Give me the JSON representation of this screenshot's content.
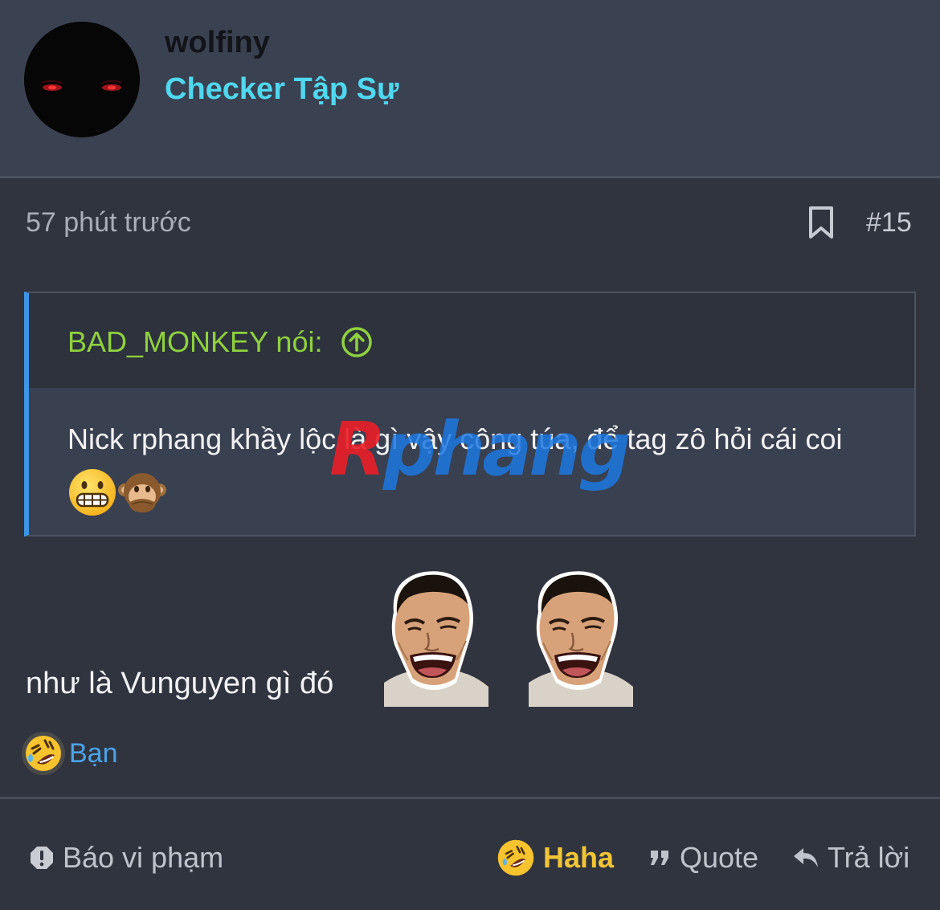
{
  "post": {
    "author": {
      "name": "wolfiny",
      "title": "Checker Tập Sự",
      "avatar_icon": "dark-avatar-red-eyes"
    },
    "timestamp": "57 phút trước",
    "post_number": "#15",
    "quote": {
      "author_label": "BAD_MONKEY nói:",
      "text": "Nick rphang khầy lộc là gì vậy công túa, để tag zô hỏi cái coi",
      "emojis": [
        "grimacing-face-emoji",
        "speak-no-evil-monkey-emoji"
      ]
    },
    "message": "như là Vunguyen gì đó",
    "stickers": [
      "laughing-face-sticker",
      "laughing-face-sticker"
    ],
    "reactions": {
      "icon": "rolling-laughing-emoji",
      "text": "Bạn"
    }
  },
  "watermark": {
    "first": "R",
    "rest": "phang"
  },
  "actions": {
    "report": "Báo vi phạm",
    "react": "Haha",
    "quote": "Quote",
    "reply": "Trả lời"
  },
  "colors": {
    "background": "#30343f",
    "header": "#3a4150",
    "title_cyan": "#4fd8ef",
    "quote_author_green": "#8fd13e",
    "quote_bar_blue": "#3e95e6",
    "link_blue": "#4aa3ea",
    "haha_yellow": "#f2c535"
  }
}
